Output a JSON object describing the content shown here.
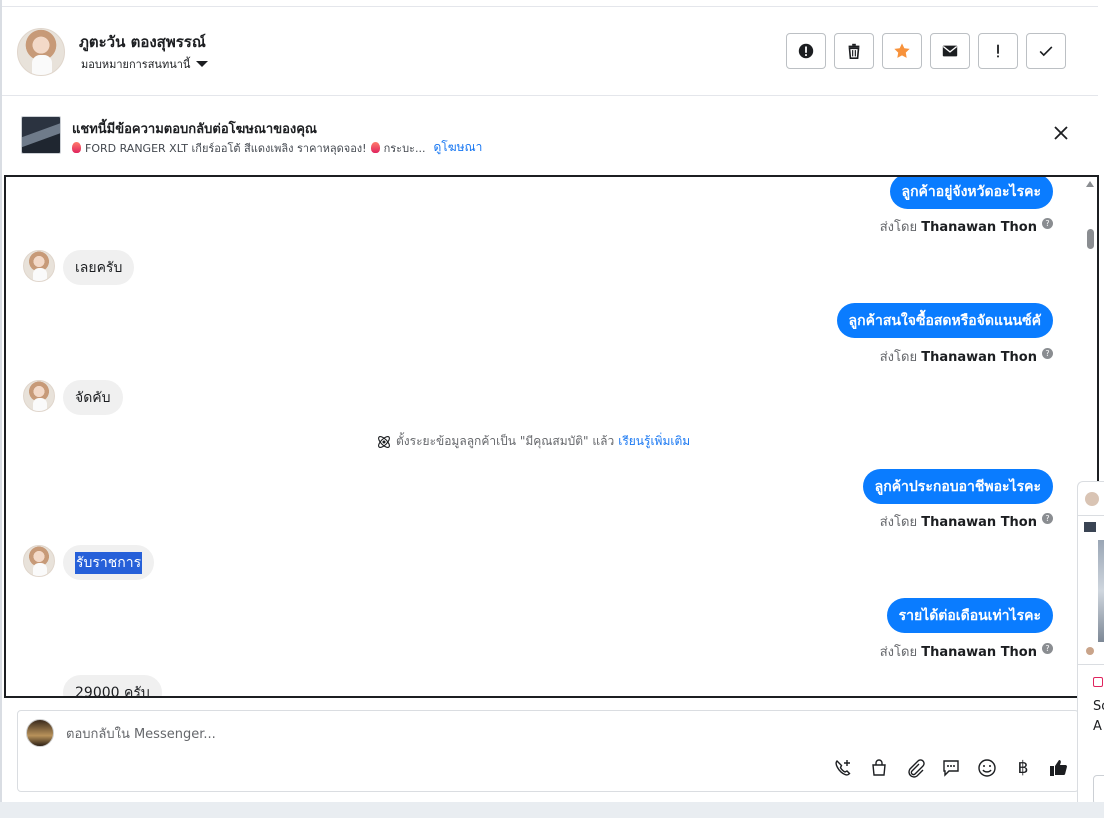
{
  "header": {
    "contact_name": "ภูตะวัน ตองสุพรรณ์",
    "assign_label": "มอบหมายการสนทนานี้",
    "actions": [
      {
        "name": "mark-spam-button",
        "icon": "exclamation-circle-icon"
      },
      {
        "name": "delete-button",
        "icon": "trash-icon"
      },
      {
        "name": "star-button",
        "icon": "star-icon",
        "color": "#f7923b"
      },
      {
        "name": "mark-unread-button",
        "icon": "envelope-icon"
      },
      {
        "name": "follow-up-button",
        "icon": "exclamation-icon"
      },
      {
        "name": "mark-done-button",
        "icon": "checkmark-icon"
      }
    ]
  },
  "ad_banner": {
    "title": "แชทนี้มีข้อความตอบกลับต่อโฆษณาของคุณ",
    "snippet_a": "FORD RANGER XLT เกียร์ออโต้ สีแดงเพลิง ราคาหลุดจอง!",
    "snippet_b": "กระบะ...",
    "link": "ดูโฆษณา"
  },
  "thread": {
    "messages": [
      {
        "dir": "out",
        "text": "ลูกค้าอยู่จังหวัดอะไรคะ"
      },
      {
        "dir": "in",
        "text": "เลยครับ"
      },
      {
        "dir": "out",
        "text": "ลูกค้าสนใจซื้อสดหรือจัดแนนซ์คั"
      },
      {
        "dir": "in",
        "text": "จัดคับ"
      },
      {
        "dir": "out",
        "text": "ลูกค้าประกอบอาชีพอะไรคะ"
      },
      {
        "dir": "in",
        "text": "รับราชการ"
      },
      {
        "dir": "out",
        "text": "รายได้ต่อเดือนเท่าไรคะ"
      },
      {
        "dir": "in",
        "text": "29000 ครับ"
      }
    ],
    "sent_by_prefix": "ส่งโดย",
    "sent_by_name": "Thanawan Thon",
    "system_note": {
      "text": "ตั้งระยะข้อมูลลูกค้าเป็น \"มีคุณสมบัติ\" แล้ว",
      "link": "เรียนรู้เพิ่มเติม"
    }
  },
  "composer": {
    "placeholder": "ตอบกลับใน Messenger...",
    "tools": [
      "phone-plus-icon",
      "shopping-bag-icon",
      "paperclip-icon",
      "saved-reply-icon",
      "emoji-icon",
      "baht-icon",
      "thumbs-up-icon"
    ],
    "baht_symbol": "฿",
    "like_color": "#1c1e21"
  },
  "side_panel": {
    "text_lines": [
      "So",
      "A"
    ]
  },
  "colors": {
    "accent": "#0a7cff",
    "link": "#1877f2",
    "incoming_bubble": "#f0f0f0"
  }
}
